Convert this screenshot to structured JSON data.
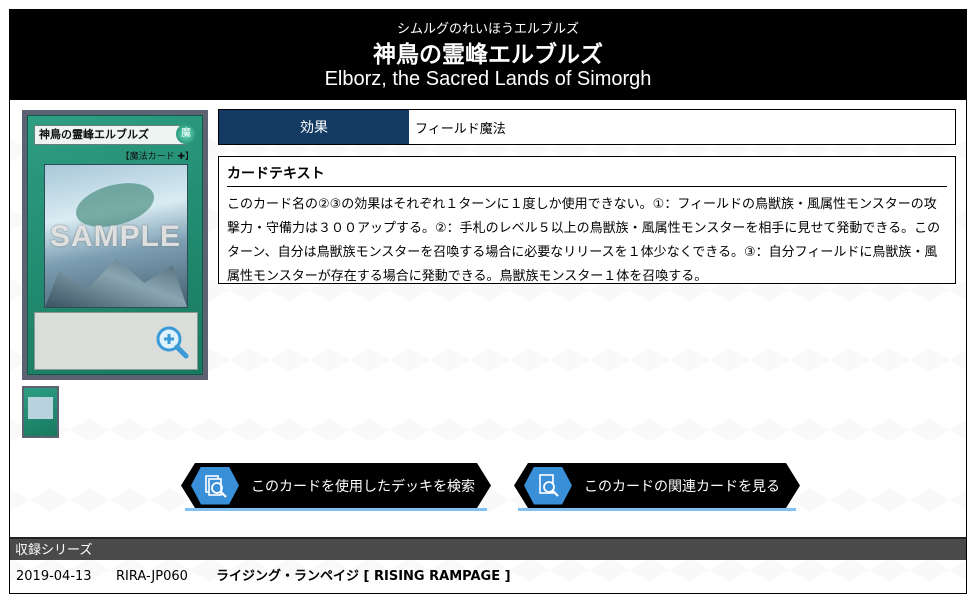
{
  "header": {
    "ruby": "シムルグのれいほうエルブルズ",
    "name_jp": "神鳥の霊峰エルブルズ",
    "name_en": "Elborz, the Sacred Lands of Simorgh"
  },
  "card_image": {
    "title": "神鳥の霊峰エルブルズ",
    "attribute_glyph": "魔",
    "type_line": "【魔法カード ✚】",
    "watermark": "SAMPLE",
    "zoom_icon": "zoom-in-icon"
  },
  "effect": {
    "label": "効果",
    "value": "フィールド魔法"
  },
  "card_text": {
    "heading": "カードテキスト",
    "body": "このカード名の②③の効果はそれぞれ１ターンに１度しか使用できない。①：フィールドの鳥獣族・風属性モンスターの攻撃力・守備力は３００アップする。②：手札のレベル５以上の鳥獣族・風属性モンスターを相手に見せて発動できる。このターン、自分は鳥獣族モンスターを召喚する場合に必要なリリースを１体少なくできる。③：自分フィールドに鳥獣族・風属性モンスターが存在する場合に発動できる。鳥獣族モンスター１体を召喚する。"
  },
  "buttons": {
    "deck_search": "このカードを使用したデッキを検索",
    "related_cards": "このカードの関連カードを見る"
  },
  "series": {
    "heading": "収録シリーズ",
    "rows": [
      {
        "date": "2019-04-13",
        "code": "RIRA-JP060",
        "title": "ライジング・ランペイジ [ RISING RAMPAGE ]"
      }
    ]
  },
  "colors": {
    "header_bg": "#000000",
    "effect_label_bg": "#133a63",
    "button_icon_bg": "#3a8fd9",
    "series_bar_bg": "#4a4a4a"
  }
}
